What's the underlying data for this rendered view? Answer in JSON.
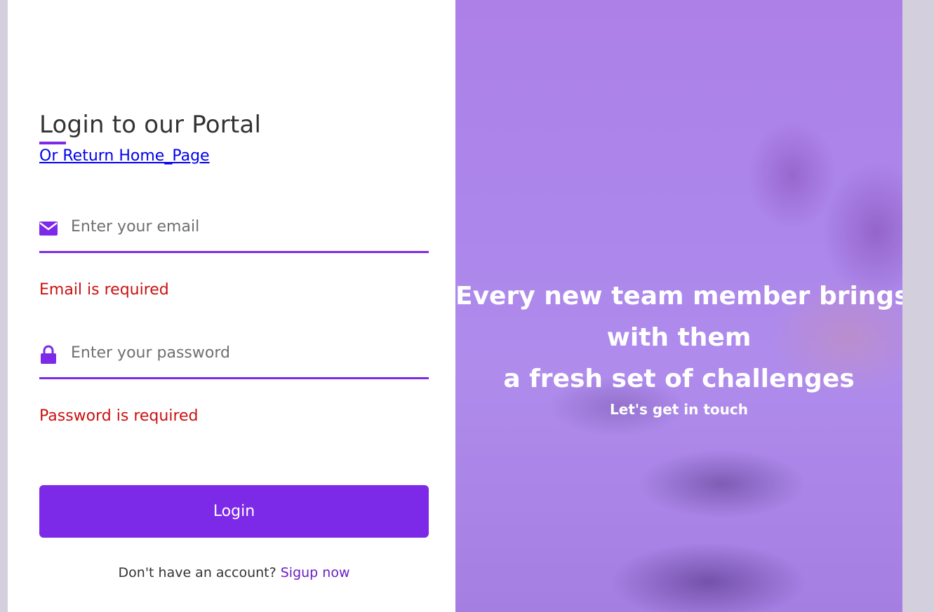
{
  "form": {
    "title": "Login to our Portal",
    "home_link": "Or Return Home_Page",
    "email": {
      "placeholder": "Enter your email",
      "value": "",
      "icon": "envelope-icon",
      "error": "Email is required"
    },
    "password": {
      "placeholder": "Enter your password",
      "value": "",
      "icon": "lock-icon",
      "error": "Password is required"
    },
    "login_button": "Login",
    "signup_prompt": "Don't have an account?",
    "signup_link": "Sigup now"
  },
  "cover": {
    "lines": [
      "Every new team member brings",
      "with them",
      "a fresh set of challenges"
    ],
    "subtitle": "Let's get in touch"
  },
  "colors": {
    "accent": "#7d2ae8",
    "error": "#cc1010",
    "link": "#0000ee",
    "signup_link": "#6a1fc6"
  }
}
